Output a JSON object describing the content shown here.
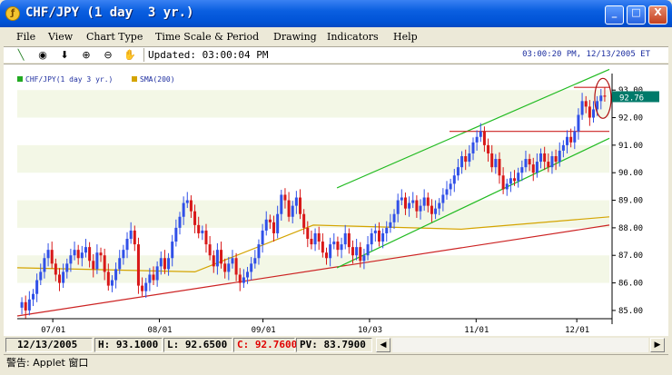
{
  "window": {
    "title": "CHF/JPY (1 day  3 yr.)",
    "minimize": "_",
    "maximize": "□",
    "close": "X"
  },
  "menu": [
    "File",
    "View",
    "Chart Type",
    "Time Scale & Period",
    "Drawing",
    "Indicators",
    "Help"
  ],
  "toolbar": {
    "icons": [
      "pencil-icon",
      "target-icon",
      "down-arrow-icon",
      "zoom-in-icon",
      "zoom-out-icon",
      "grab-icon"
    ],
    "updated": "Updated: 03:00:04 PM",
    "clock": "03:00:20 PM, 12/13/2005 ET"
  },
  "legend": [
    {
      "label": "CHF/JPY(1 day  3 yr.)",
      "color": "#22aa22"
    },
    {
      "label": "SMA(200)",
      "color": "#d4a400"
    }
  ],
  "chart_data": {
    "type": "candlestick",
    "y_ticks": [
      "85.00",
      "86.00",
      "87.00",
      "88.00",
      "89.00",
      "90.00",
      "91.00",
      "92.00",
      "93.00"
    ],
    "x_ticks": [
      "07/01",
      "08/01",
      "09/01",
      "10/03",
      "11/01",
      "12/01"
    ],
    "ylim": [
      84.7,
      93.6
    ],
    "current_price": "92.76",
    "colors": {
      "up": "#3050e8",
      "down": "#d81818",
      "sma": "#d4a400",
      "channel": "#22bb22",
      "support": "#cc2222",
      "bg_band": "#f3f7e6"
    },
    "sma200": [
      [
        0,
        86.55
      ],
      [
        0.3,
        86.4
      ],
      [
        0.5,
        88.1
      ],
      [
        0.75,
        87.95
      ],
      [
        1.0,
        88.4
      ]
    ],
    "upper_channel": [
      [
        0.54,
        89.45
      ],
      [
        1.0,
        93.75
      ]
    ],
    "lower_channel": [
      [
        0.54,
        86.55
      ],
      [
        1.0,
        91.25
      ]
    ],
    "support_line": [
      [
        0.0,
        84.8
      ],
      [
        1.0,
        88.1
      ]
    ],
    "resistance_line": [
      [
        0.73,
        91.5
      ],
      [
        1.0,
        91.5
      ]
    ],
    "top_line": [
      [
        0.94,
        93.1
      ],
      [
        1.0,
        93.1
      ]
    ],
    "closes": [
      85.3,
      85.0,
      85.4,
      85.6,
      86.1,
      86.4,
      86.9,
      87.2,
      86.7,
      86.3,
      86.0,
      86.4,
      86.7,
      87.0,
      87.2,
      86.9,
      87.1,
      87.3,
      86.8,
      86.5,
      87.1,
      87.0,
      86.4,
      85.9,
      86.1,
      86.5,
      86.9,
      87.2,
      87.6,
      87.9,
      87.4,
      85.9,
      85.7,
      86.0,
      86.3,
      86.1,
      86.6,
      86.9,
      86.5,
      86.9,
      87.5,
      88.0,
      88.4,
      88.9,
      89.0,
      88.6,
      88.1,
      87.8,
      87.9,
      87.4,
      87.0,
      86.6,
      87.2,
      86.7,
      86.4,
      86.7,
      86.9,
      86.3,
      86.0,
      86.2,
      86.4,
      86.7,
      86.9,
      87.4,
      87.9,
      88.3,
      88.2,
      87.8,
      88.5,
      89.2,
      89.0,
      88.4,
      88.8,
      89.1,
      88.5,
      88.0,
      87.6,
      87.4,
      87.8,
      87.5,
      87.1,
      86.9,
      87.4,
      87.5,
      87.2,
      87.4,
      87.8,
      87.3,
      87.0,
      87.3,
      86.8,
      87.0,
      87.4,
      87.8,
      87.9,
      87.5,
      87.8,
      88.0,
      88.2,
      88.5,
      89.0,
      89.1,
      88.7,
      88.9,
      89.0,
      88.6,
      88.8,
      89.1,
      88.8,
      88.5,
      88.7,
      88.9,
      89.2,
      89.4,
      89.6,
      89.9,
      90.2,
      90.6,
      90.4,
      90.7,
      91.1,
      91.3,
      91.5,
      91.0,
      90.7,
      90.2,
      90.5,
      89.9,
      89.4,
      89.6,
      89.8,
      89.7,
      90.0,
      90.2,
      90.5,
      90.3,
      90.0,
      90.4,
      90.7,
      90.4,
      90.2,
      90.6,
      90.4,
      90.8,
      91.0,
      91.3,
      91.1,
      91.5,
      92.1,
      92.6,
      92.4,
      92.0,
      92.3,
      92.6,
      92.8,
      92.76
    ]
  },
  "status": {
    "date": "12/13/2005",
    "high": "H: 93.1000",
    "low": "L: 92.6500",
    "close": "C: 92.7600",
    "pv": "PV: 83.7900",
    "close_color": "#e00000"
  },
  "applet_status": "警告: Applet 窗口"
}
